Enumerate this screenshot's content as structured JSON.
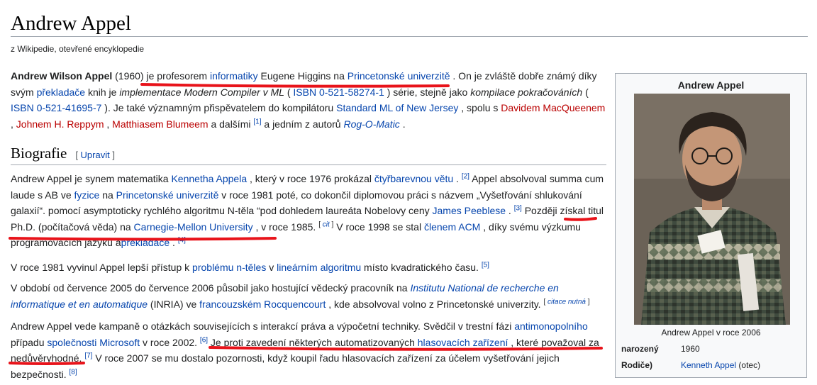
{
  "page": {
    "title": "Andrew Appel",
    "tagline": "z Wikipedie, otevřené encyklopedie"
  },
  "intro": {
    "name": "Andrew Wilson Appel",
    "t1": " (1960) je profesorem ",
    "l_informatiky": "informatiky",
    "t2": " Eugene Higgins na ",
    "l_princeton": "Princetonské univerzitě",
    "t3": " . On je zvláště dobře známý díky svým ",
    "l_prekladace": "překladače",
    "t4": " knih je ",
    "i_modern": "implementace Modern Compiler v ML",
    "t5": " ( ",
    "l_isbn1": "ISBN  0-521-58274-1",
    "t6": " ) série, stejně jako ",
    "i_kompilace": "kompilace pokračováních",
    "t7": " ( ",
    "l_isbn2": "ISBN 0-521-41695-7",
    "t8": " ). Je také významným přispěvatelem do kompilátoru ",
    "l_sml": "Standard ML of New Jersey",
    "t9": " , spolu s ",
    "l_macqueen": "Davidem MacQueenem",
    "t10": " , ",
    "l_reppy": "Johnem H. Reppym",
    "t11": " , ",
    "l_blume": "Matthiasem Blumeem",
    "t12": " a dalšími ",
    "ref1": "[1]",
    "t13": " a jedním z autorů ",
    "l_rogomatic": "Rog-O-Matic",
    "t14": " ."
  },
  "section": {
    "heading": "Biografie",
    "edit_open": "[ ",
    "edit_label": "Upravit",
    "edit_close": " ]"
  },
  "bio1": {
    "t1": "Andrew Appel je synem matematika ",
    "l_kenneth": "Kennetha Appela",
    "t2": " , který v roce 1976 prokázal ",
    "l_ctyr": "čtyřbarevnou větu",
    "t3": " . ",
    "ref2": "[2]",
    "t4": " Appel absolvoval summa cum laude s AB ve ",
    "l_fyzice": "fyzice",
    "t5": " na ",
    "l_princeton": "Princetonské univerzitě",
    "t6": " v roce 1981 poté, co dokončil diplomovou práci s názvem „Vyšetřování shlukování galaxií“. pomocí asymptoticky rychlého algoritmu N-těla “pod dohledem laureáta Nobelovy ceny ",
    "l_peebles": "James Peeblese",
    "t7": " . ",
    "ref3": "[3]",
    "t8": " Později získal titul Ph.D. (počítačová věda) na ",
    "l_cmu": "Carnegie-Mellon University",
    "t9": " , v roce 1985. ",
    "cit_open": "[ ",
    "cit": "cit",
    "cit_close": " ]",
    "t10": " V roce 1998 se stal ",
    "l_acm": "členem ACM",
    "t11": " , díky svému výzkumu programovacích jazyků a",
    "l_prekladace": "překladače",
    "t12": " . ",
    "ref4": "[4]"
  },
  "bio2": {
    "t1": "V roce 1981 vyvinul Appel lepší přístup k ",
    "l_problem": "problému n-těles",
    "t2": " v ",
    "l_linear": "lineárním algoritmu",
    "t3": " místo kvadratického času. ",
    "ref5": "[5]"
  },
  "bio3": {
    "t1": "V období od července 2005 do července 2006 působil jako hostující vědecký pracovník na ",
    "l_inria": "Institutu National de recherche en informatique et en automatique",
    "t2": " (INRIA) ve ",
    "l_rocq": "francouzském Rocquencourt",
    "t3": " , kde absolvoval volno z Princetonské univerzity. ",
    "cn_open": "[ ",
    "cn": "citace nutná",
    "cn_close": " ]"
  },
  "bio4": {
    "t1": "Andrew Appel vede kampaně o otázkách souvisejících s interakcí práva a výpočetní techniky. Svědčil v trestní fázi ",
    "l_antimon": "antimonopolního",
    "t2": " případu ",
    "l_ms": "společnosti Microsoft",
    "t3": " v roce 2002. ",
    "ref6": "[6]",
    "t4": " Je proti zavedení některých automatizovaných ",
    "l_hlas": "hlasovacích zařízení",
    "t5": " , které považoval za nedůvěryhodné. ",
    "ref7": "[7]",
    "t6": " V roce 2007 se mu dostalo pozornosti, když koupil řadu hlasovacích zařízení za účelem vyšetřování jejich bezpečnosti. ",
    "ref8": "[8]"
  },
  "infobox": {
    "title": "Andrew Appel",
    "caption": "Andrew Appel v roce 2006",
    "born_label": "narozený",
    "born_value": "1960",
    "parents_label": "Rodiče)",
    "parents_link": "Kenneth Appel",
    "parents_suffix": " (otec)"
  },
  "colors": {
    "link": "#0645ad",
    "redlink": "#ba0000",
    "annotation": "#e8131a"
  }
}
